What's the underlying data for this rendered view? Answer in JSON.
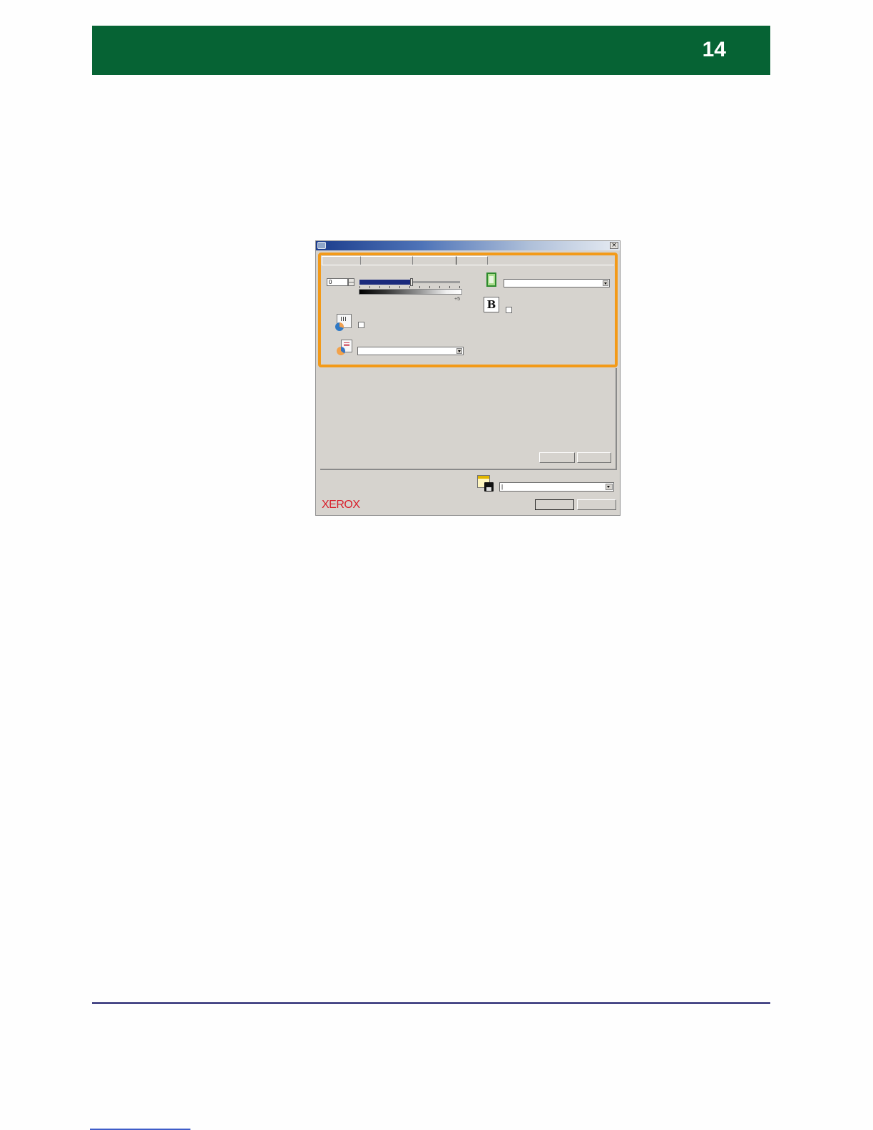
{
  "header": {
    "page_number": "14",
    "background": "#066334",
    "text_color": "#ffffff"
  },
  "dialog": {
    "highlight_color": "#f39a18",
    "icons": {
      "title": "printer-properties-icon",
      "close": "close-icon",
      "doc_chart": "document-chart-icon",
      "doc_color": "document-color-icon",
      "page": "page-green-icon",
      "bold": "bold-icon",
      "saved_settings": "save-settings-icon"
    },
    "close_glyph": "×",
    "spin_value": "0",
    "slider_level_fraction": 0.5,
    "plus_label": "+5",
    "bold_glyph": "B",
    "saved_settings_value": "|",
    "brand": {
      "logo_text": "XEROX",
      "color": "#d81e2a"
    }
  },
  "footer": {
    "rule_color": "#1d1d6b",
    "link_color": "#3f5cc8"
  }
}
